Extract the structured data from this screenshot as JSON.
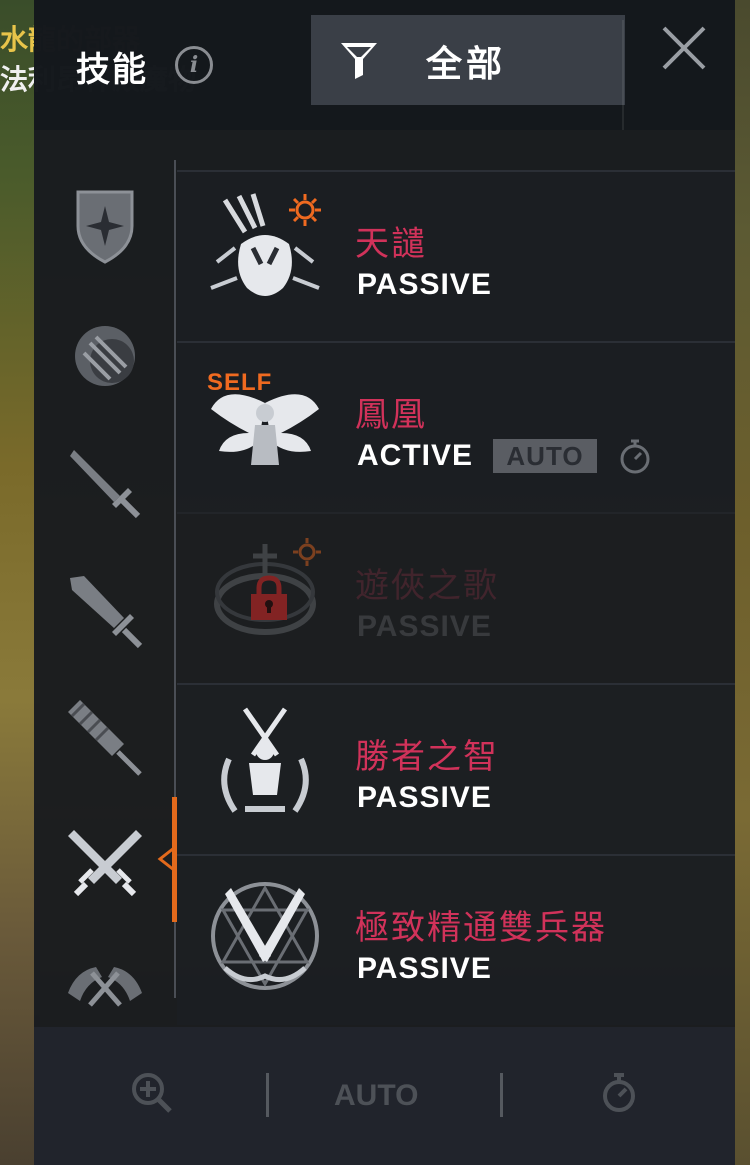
{
  "background": {
    "line1": "水龍的部器",
    "line2": "法利昂神殿魔物"
  },
  "header": {
    "title": "技能",
    "info_icon": "info-icon",
    "filter_label": "全部",
    "filter_icon": "filter-icon",
    "close_icon": "close-icon"
  },
  "categories": [
    {
      "icon": "shield-star-icon",
      "active": false
    },
    {
      "icon": "orb-icon",
      "active": false
    },
    {
      "icon": "sword-icon",
      "active": false
    },
    {
      "icon": "greatsword-icon",
      "active": false
    },
    {
      "icon": "spear-icon",
      "active": false
    },
    {
      "icon": "dual-swords-icon",
      "active": true
    },
    {
      "icon": "axes-icon",
      "active": false
    }
  ],
  "skills": [
    {
      "name": "天譴",
      "type": "PASSIVE",
      "icon": "claw-skill-icon",
      "locked": false
    },
    {
      "name": "鳳凰",
      "type": "ACTIVE",
      "icon": "phoenix-skill-icon",
      "tag": "SELF",
      "auto": "AUTO",
      "locked": false
    },
    {
      "name": "遊俠之歌",
      "type": "PASSIVE",
      "icon": "ranger-song-skill-icon",
      "locked": true
    },
    {
      "name": "勝者之智",
      "type": "PASSIVE",
      "icon": "victor-skill-icon",
      "locked": false
    },
    {
      "name": "極致精通雙兵器",
      "type": "PASSIVE",
      "icon": "dual-mastery-skill-icon",
      "locked": false
    }
  ],
  "toolbar": {
    "zoom_icon": "zoom-in-icon",
    "auto_label": "AUTO",
    "timer_icon": "stopwatch-icon"
  },
  "colors": {
    "accent": "#e36a1c",
    "skill_name": "#d1325a",
    "panel": "#16191e"
  }
}
